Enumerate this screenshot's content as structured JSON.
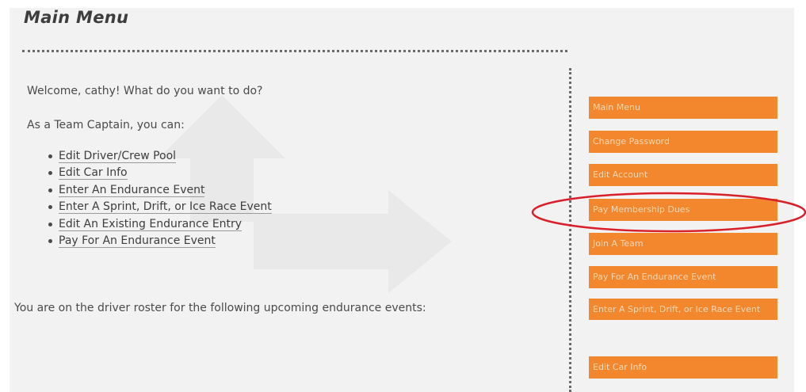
{
  "header": {
    "title": "Main Menu"
  },
  "main": {
    "welcome_text": "Welcome, cathy! What do you want to do?",
    "role_text": "As a Team Captain, you can:",
    "actions": [
      "Edit Driver/Crew Pool",
      "Edit Car Info",
      "Enter An Endurance Event",
      "Enter A Sprint, Drift, or Ice Race Event",
      "Edit An Existing Endurance Entry",
      "Pay For An Endurance Event"
    ],
    "roster_text": "You are on the driver roster for the following upcoming endurance events:"
  },
  "sidebar": {
    "items": [
      "Main Menu",
      "Change Password",
      "Edit Account",
      "Pay Membership Dues",
      "Join A Team",
      "Pay For An Endurance Event",
      "Enter A Sprint, Drift, or Ice Race Event",
      "Edit Car Info"
    ]
  },
  "colors": {
    "nav_button_bg": "#f2872e",
    "nav_button_text": "#fbd8b6",
    "highlight_ellipse": "#d8202a",
    "panel_bg": "#f2f2f2"
  }
}
